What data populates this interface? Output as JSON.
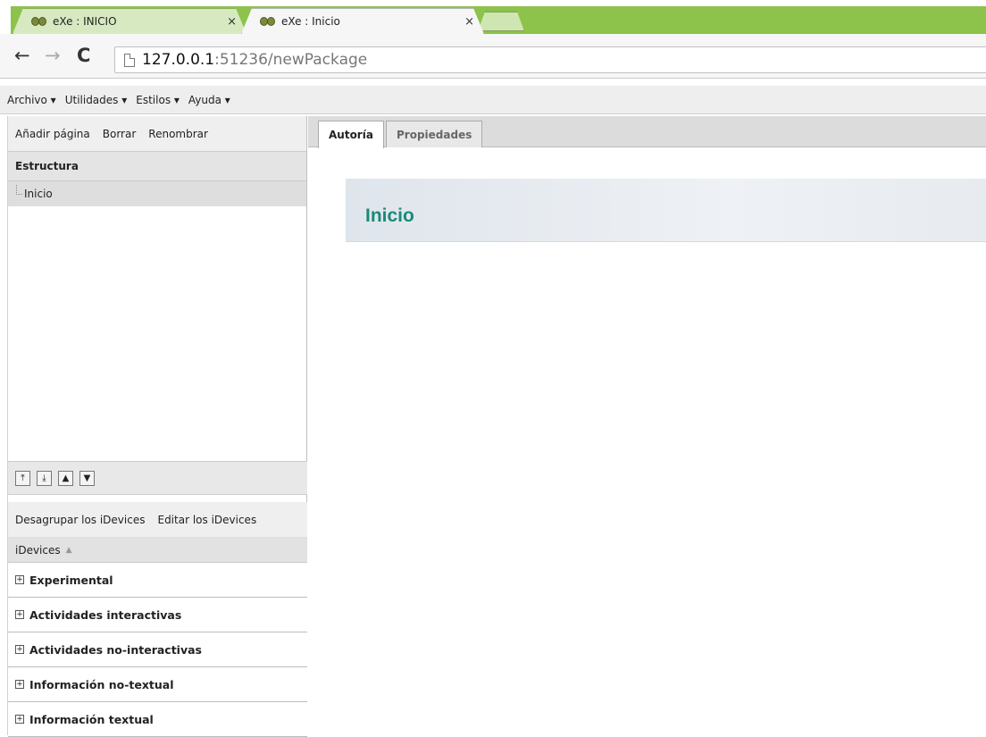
{
  "browser": {
    "tabs": [
      {
        "title": "eXe : INICIO",
        "close": "×",
        "active": false
      },
      {
        "title": "eXe : Inicio",
        "close": "×",
        "active": true
      }
    ],
    "nav": {
      "back": "←",
      "forward": "→",
      "reload": "C"
    },
    "url": {
      "host": "127.0.0.1",
      "rest": ":51236/newPackage"
    }
  },
  "menubar": {
    "items": [
      "Archivo ▾",
      "Utilidades ▾",
      "Estilos ▾",
      "Ayuda ▾"
    ]
  },
  "left_panel": {
    "toolbar": [
      "Añadir página",
      "Borrar",
      "Renombrar"
    ],
    "structure_header": "Estructura",
    "tree": [
      {
        "label": "Inicio"
      }
    ],
    "move_buttons": [
      "⤒",
      "⤓",
      "▲",
      "▼"
    ],
    "idevices_toolbar": [
      "Desagrupar los iDevices",
      "Editar los iDevices"
    ],
    "idevices_header": "iDevices",
    "idevices_sort_icon": "▲",
    "categories": [
      "Experimental",
      "Actividades interactivas",
      "Actividades no-interactivas",
      "Información no-textual",
      "Información textual"
    ],
    "expand_glyph": "+"
  },
  "right_panel": {
    "tabs": [
      "Autoría",
      "Propiedades"
    ],
    "page_title": "Inicio"
  },
  "colors": {
    "tabstrip_green": "#8dc24b",
    "title_teal": "#1a8a78"
  }
}
